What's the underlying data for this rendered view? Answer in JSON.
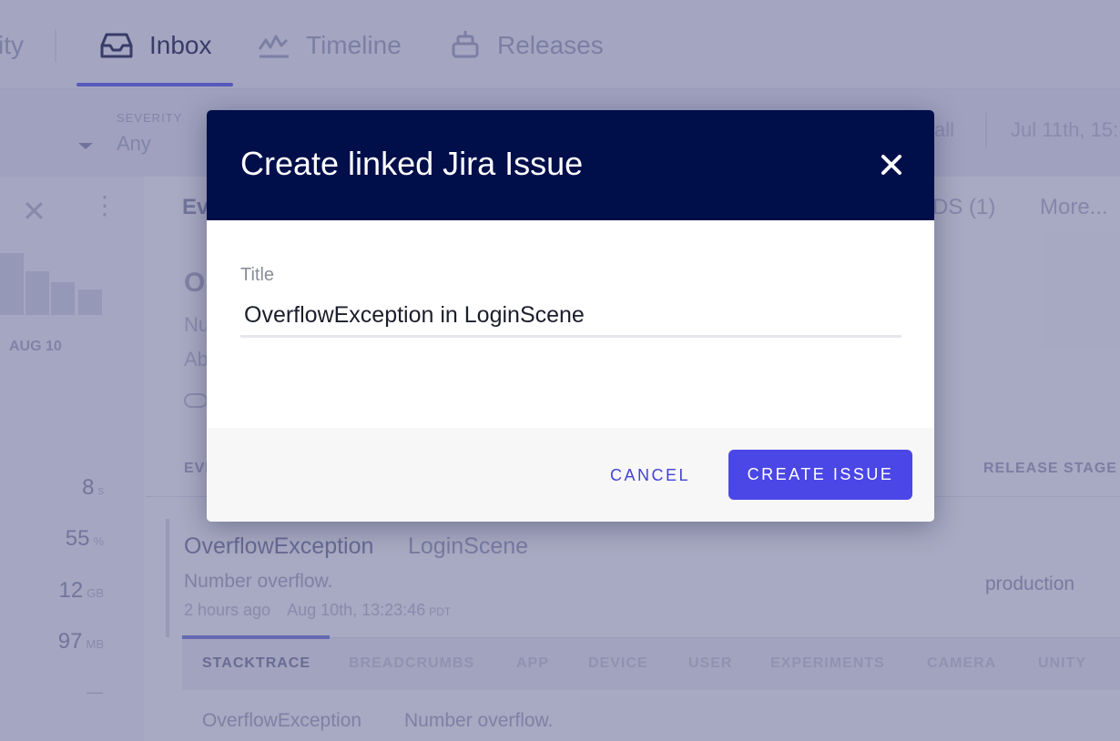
{
  "nav": {
    "partial_item": "ity",
    "items": [
      {
        "label": "Inbox",
        "icon": "inbox-icon",
        "active": true
      },
      {
        "label": "Timeline",
        "icon": "timeline-icon",
        "active": false
      },
      {
        "label": "Releases",
        "icon": "releases-icon",
        "active": false
      }
    ]
  },
  "filters": {
    "severity_label": "SEVERITY",
    "severity_value": "Any",
    "partial_all": "all",
    "date": "Jul 11th, 15:"
  },
  "sidebar": {
    "date_label": "AUG 10",
    "stats": [
      {
        "value": "8",
        "unit": "s"
      },
      {
        "value": "55",
        "unit": "%"
      },
      {
        "value": "12",
        "unit": "GB"
      },
      {
        "value": "97",
        "unit": "MB"
      }
    ],
    "dash": "—"
  },
  "main": {
    "tab_ev": "Ev",
    "tab_ds": "DS (1)",
    "tab_more": "More...",
    "error_title_partial": "O",
    "line1_partial": "Nu",
    "line2_partial": "Ab",
    "table_head_ev": "EVI",
    "table_head_release": "RELEASE STAGE",
    "event": {
      "name": "OverflowException",
      "location": "LoginScene",
      "message": "Number overflow.",
      "relative_time": "2 hours ago",
      "timestamp": "Aug 10th, 13:23:46",
      "tz": "PDT",
      "release_stage": "production"
    },
    "subtabs": [
      "STACKTRACE",
      "BREADCRUMBS",
      "APP",
      "DEVICE",
      "USER",
      "EXPERIMENTS",
      "CAMERA",
      "UNITY"
    ],
    "trace": {
      "name": "OverflowException",
      "message": "Number overflow."
    }
  },
  "modal": {
    "title": "Create linked Jira Issue",
    "field_label": "Title",
    "field_value": "OverflowException in LoginScene",
    "cancel_label": "CANCEL",
    "create_label": "CREATE ISSUE",
    "colors": {
      "header_bg": "#000e4a",
      "primary": "#4b46e6",
      "cancel_text": "#4343d6"
    }
  }
}
